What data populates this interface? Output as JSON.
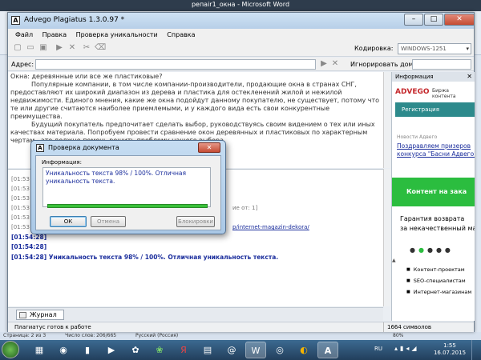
{
  "word": {
    "title": "репair1_окна - Microsoft Word",
    "status_page": "Страница: 2 из 3",
    "status_words": "Число слов: 206/665",
    "status_lang": "Русский (Россия)",
    "status_zoom": "80%"
  },
  "app": {
    "title": "Advego Plagiatus 1.3.0.97 *",
    "icon_letter": "A",
    "minimize": "–",
    "maximize": "□",
    "close": "✕"
  },
  "menu": [
    "Файл",
    "Правка",
    "Проверка уникальности",
    "Справка"
  ],
  "toolbar": {
    "encoding_label": "Кодировка:",
    "encoding_value": "WINDOWS-1251"
  },
  "addressbar": {
    "address_label": "Адрес:",
    "address_value": "",
    "ignore_label": "Игнорировать домены:",
    "ignore_value": ""
  },
  "document": {
    "line1": "Окна: деревянные или все же  пластиковые?",
    "para1": "Популярные компании, в том числе компании-производители, продающие окна в странах СНГ, предоставляют их широкий  диапазон из дерева и пластика для остекленений жилой и нежилой недвижимости. Единого мнения,  какие же окна подойдут данному покупателю, не существует, потому что те или другие считаются наиболее приемлемыми, и у каждого вида есть свои конкурентные преимущества.",
    "para2": "Будущий покупатель предпочитает сделать выбор, руководствуясь своим видением о тех или иных качествах материала. Попробуем провести сравнение окон деревянных и пластиковых  по характерным чертам - это должно помочь решить проблему нашего выбора."
  },
  "log": {
    "lines": [
      "[01:53",
      "[01:53",
      "[01:53",
      "[01:53",
      "[01:53",
      "[01:53"
    ],
    "line_suffix": "ие от: 1]",
    "link": "p/internet-magazin-dekora/",
    "bold1": "[01:54:28]",
    "bold2": "[01:54:28]",
    "result": "[01:54:28] Уникальность текста 98% / 100%. Отличная уникальность текста."
  },
  "tab": {
    "label": "Журнал"
  },
  "status": {
    "ready": "Плагиатус готов к работе",
    "chars": "1664 символов"
  },
  "info": {
    "header": "Информация",
    "close": "✕",
    "logo": "ADVEGO",
    "logo_sub": "Биржа контента",
    "nav": "Регистрация",
    "news_label": "Новости Адвего",
    "news_link_1": "Поздравляем призеров",
    "news_link_2": "конкурса \"Басни Адвего\"",
    "banner1": "Контент на зака",
    "banner2_1": "Гарантия возврата",
    "banner2_2": "за некачественный мат",
    "list": [
      "Контент-проектам",
      "SEO-специалистам",
      "Интернет-магазинам"
    ]
  },
  "dialog": {
    "title": "Проверка документа",
    "icon_letter": "A",
    "close": "✕",
    "group_label": "Информация:",
    "message": "Уникальность текста 98% / 100%. Отличная уникальность текста.",
    "progress": 1.0,
    "ok": "ОК",
    "cancel": "Отмена",
    "block": "Блокировки"
  },
  "taskbar": {
    "lang": "RU",
    "time": "1:55",
    "date": "16.07.2015",
    "apps": [
      "ICQ",
      "Yandex",
      "Mail",
      "Word",
      "Chrome",
      "Advego"
    ]
  }
}
